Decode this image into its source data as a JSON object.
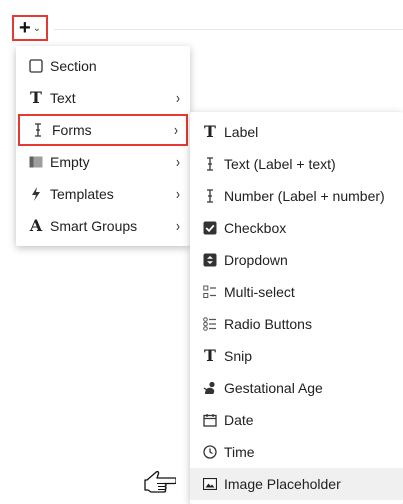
{
  "toolbar": {
    "add_button": {
      "icon": "plus-icon",
      "dropdown_icon": "chevron-down-icon"
    }
  },
  "colors": {
    "highlight": "#e53935",
    "hover": "#f0f0f0",
    "icon": "#333333"
  },
  "menu": {
    "items": [
      {
        "label": "Section",
        "icon": "checkbox-outline-icon"
      },
      {
        "label": "Text",
        "icon": "text-t-icon",
        "has_submenu": true
      },
      {
        "label": "Forms",
        "icon": "text-cursor-icon",
        "has_submenu": true,
        "selected": true
      },
      {
        "label": "Empty",
        "icon": "empty-block-icon",
        "has_submenu": true
      },
      {
        "label": "Templates",
        "icon": "lightning-icon",
        "has_submenu": true
      },
      {
        "label": "Smart Groups",
        "icon": "letter-a-icon",
        "has_submenu": true
      }
    ]
  },
  "forms_submenu": {
    "items": [
      {
        "label": "Label",
        "icon": "text-t-icon"
      },
      {
        "label": "Text (Label + text)",
        "icon": "text-cursor-icon"
      },
      {
        "label": "Number (Label + number)",
        "icon": "text-cursor-icon"
      },
      {
        "label": "Checkbox",
        "icon": "checkbox-checked-icon"
      },
      {
        "label": "Dropdown",
        "icon": "dropdown-icon"
      },
      {
        "label": "Multi-select",
        "icon": "multi-select-icon"
      },
      {
        "label": "Radio Buttons",
        "icon": "radio-list-icon"
      },
      {
        "label": "Snip",
        "icon": "text-t-icon"
      },
      {
        "label": "Gestational Age",
        "icon": "baby-icon"
      },
      {
        "label": "Date",
        "icon": "calendar-icon"
      },
      {
        "label": "Time",
        "icon": "clock-icon"
      },
      {
        "label": "Image Placeholder",
        "icon": "image-icon",
        "hovered": true
      }
    ]
  }
}
